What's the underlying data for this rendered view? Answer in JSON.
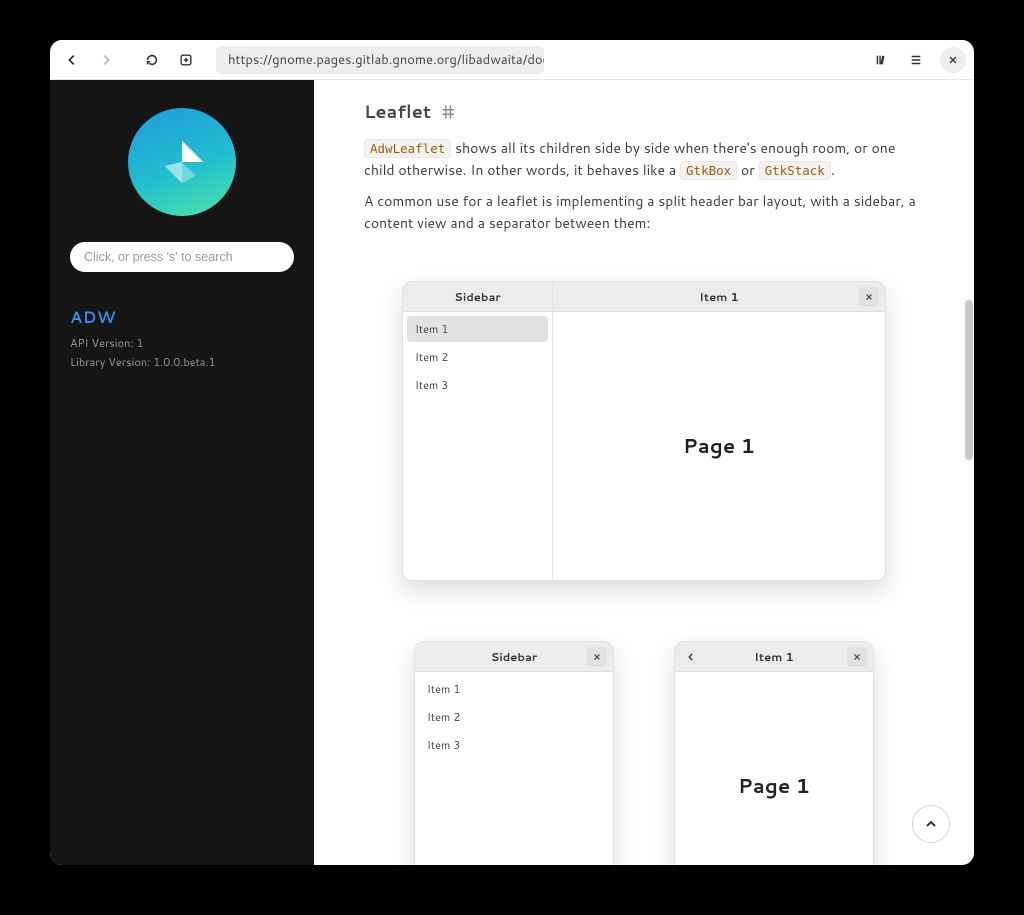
{
  "browser": {
    "url": "https://gnome.pages.gitlab.gnome.org/libadwaita/doc/main/adaptive-layouts.html"
  },
  "sidebar": {
    "search_placeholder": "Click, or press 's' to search",
    "library_name": "ADW",
    "api_version_label": "API Version: 1",
    "library_version_label": "Library Version: 1.0.0.beta.1"
  },
  "article": {
    "heading": "Leaflet",
    "anchor": "#",
    "p1_code_leaflet": "AdwLeaflet",
    "p1_text_a": " shows all its children side by side when there's enough room, or one child otherwise. In other words, it behaves like a ",
    "p1_code_box": "GtkBox",
    "p1_text_b": " or ",
    "p1_code_stack": "GtkStack",
    "p1_text_c": ".",
    "p2": "A common use for a leaflet is implementing a split header bar layout, with a sidebar, a content view and a separator between them:"
  },
  "mock": {
    "sidebar_title": "Sidebar",
    "content_title": "Item 1",
    "items": [
      "Item 1",
      "Item 2",
      "Item 3"
    ],
    "page_label": "Page 1"
  }
}
